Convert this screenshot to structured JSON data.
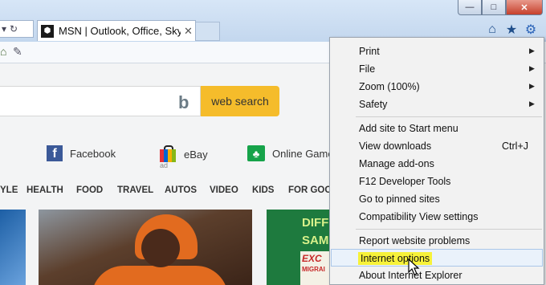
{
  "window": {
    "min_symbol": "—",
    "max_symbol": "□",
    "close_symbol": "✕"
  },
  "address_bar": {
    "icons": [
      "dropdown-icon",
      "refresh-icon"
    ],
    "dropdown_glyph": "▾",
    "refresh_glyph": "↻"
  },
  "tab": {
    "icon": "msn-favicon",
    "icon_glyph": "⬢",
    "title": "MSN | Outlook, Office, Sky...",
    "close_glyph": "✕"
  },
  "toolbar": {
    "home_glyph": "⌂",
    "favorites_glyph": "★",
    "tools_glyph": "⚙"
  },
  "page": {
    "search_button": "web search",
    "bing_glyph": "b",
    "quick_links": {
      "facebook": "Facebook",
      "ebay": "eBay",
      "ebay_ad": "ad",
      "games": "Online Games"
    },
    "categories": [
      "YLE",
      "HEALTH",
      "FOOD",
      "TRAVEL",
      "AUTOS",
      "VIDEO",
      "KIDS",
      "FOR GOOD"
    ],
    "ad": {
      "line1": "DIFF",
      "line2": "SAM",
      "box_title": "EXC",
      "box_sub": "MIGRAI"
    }
  },
  "menu": {
    "items": [
      {
        "label": "Print",
        "submenu": true
      },
      {
        "label": "File",
        "submenu": true
      },
      {
        "label": "Zoom (100%)",
        "submenu": true
      },
      {
        "label": "Safety",
        "submenu": true
      },
      {
        "label": "Add site to Start menu"
      },
      {
        "label": "View downloads",
        "shortcut": "Ctrl+J"
      },
      {
        "label": "Manage add-ons"
      },
      {
        "label": "F12 Developer Tools"
      },
      {
        "label": "Go to pinned sites"
      },
      {
        "label": "Compatibility View settings"
      },
      {
        "label": "Report website problems"
      },
      {
        "label": "Internet options",
        "highlighted": true
      },
      {
        "label": "About Internet Explorer"
      }
    ],
    "arrow_glyph": "▶"
  },
  "colors": {
    "highlight": "#f7f23a",
    "search_button": "#f5bc2b",
    "facebook": "#3b5998"
  }
}
